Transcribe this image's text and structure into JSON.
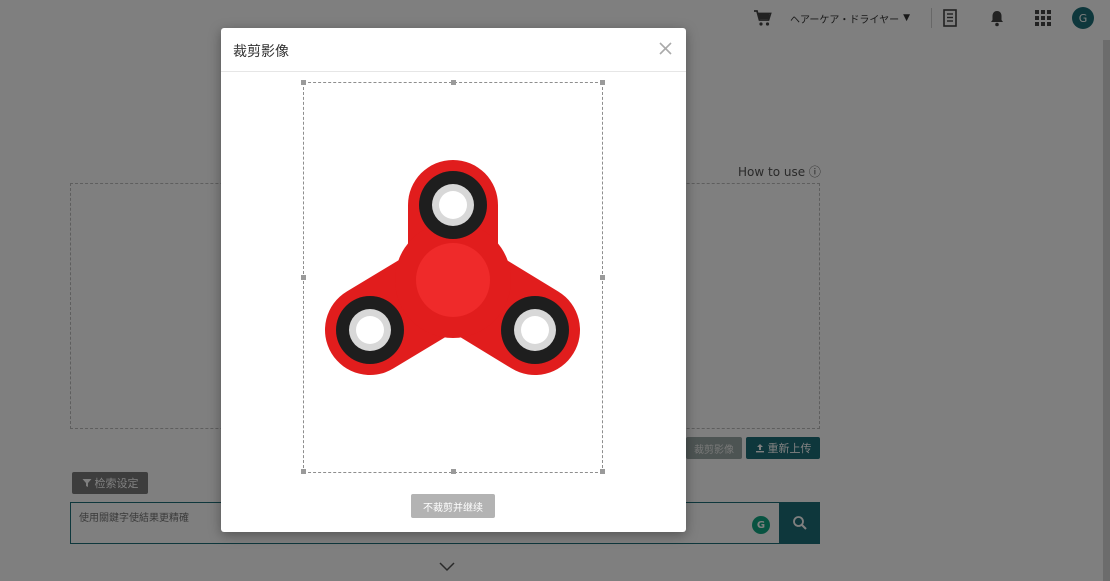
{
  "topbar": {
    "store_name": "ヘアーケア・ドライヤー",
    "caret": "▼",
    "avatar_initial": "G",
    "icons": [
      "cart-icon",
      "document-icon",
      "bell-icon",
      "apps-grid-icon"
    ]
  },
  "main": {
    "how_to_use": "How to use ⓘ",
    "crop_image_label": "裁剪影像",
    "reupload_label": "重新上传",
    "search_settings_label": "检索设定",
    "search_placeholder": "使用關鍵字使結果更精確",
    "grammarly_badge": "G"
  },
  "modal": {
    "title": "裁剪影像",
    "no_crop_continue_label": "不裁剪并继续"
  },
  "colors": {
    "brand": "#1c6f78",
    "overlay": "rgba(0,0,0,0.5)",
    "spinner": "#e11d1d"
  }
}
